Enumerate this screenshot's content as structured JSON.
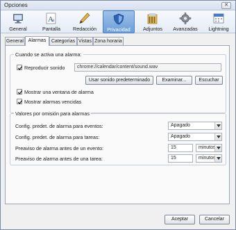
{
  "window": {
    "title": "Opciones",
    "close_glyph": "✕"
  },
  "panes": [
    {
      "label": "General",
      "icon": "monitor-icon"
    },
    {
      "label": "Pantalla",
      "icon": "font-icon"
    },
    {
      "label": "Redacción",
      "icon": "pen-icon"
    },
    {
      "label": "Privacidad",
      "icon": "shield-icon",
      "selected": true
    },
    {
      "label": "Adjuntos",
      "icon": "folder-icon"
    },
    {
      "label": "Avanzadas",
      "icon": "gear-icon"
    },
    {
      "label": "Lightning",
      "icon": "calendar-icon"
    }
  ],
  "tabs": [
    {
      "label": "General"
    },
    {
      "label": "Alarmas",
      "active": true
    },
    {
      "label": "Categorías"
    },
    {
      "label": "Vistas"
    },
    {
      "label": "Zona horaria"
    }
  ],
  "alarm_group": {
    "legend": "Cuando se activa una alarma:",
    "play_sound": {
      "label": "Reproducir sonido",
      "checked": true
    },
    "sound_path": "chrome://calendar/content/sound.wav",
    "use_default_button": "Usar sonido predeterminado",
    "browse_button": "Examinar...",
    "listen_button": "Escuchar",
    "show_window": {
      "label": "Mostrar una ventana de alarma",
      "checked": true
    },
    "show_missed": {
      "label": "Mostrar alarmas vencidas",
      "checked": true
    }
  },
  "defaults_group": {
    "legend": "Valores por omisión para alarmas",
    "event_default": {
      "label": "Config. predet. de alarma para eventos:",
      "value": "Apagado"
    },
    "task_default": {
      "label": "Config. predet. de alarma para tareas:",
      "value": "Apagado"
    },
    "event_lead": {
      "label": "Preaviso de alarma antes de un evento:",
      "number": "15",
      "unit": "minutos"
    },
    "task_lead": {
      "label": "Preaviso de alarma antes de una tarea:",
      "number": "15",
      "unit": "minutos"
    }
  },
  "footer": {
    "accept": "Aceptar",
    "cancel": "Cancelar"
  },
  "colors": {
    "selected_pane": "#6b9ed8",
    "window_bg": "#f0f0f0"
  }
}
